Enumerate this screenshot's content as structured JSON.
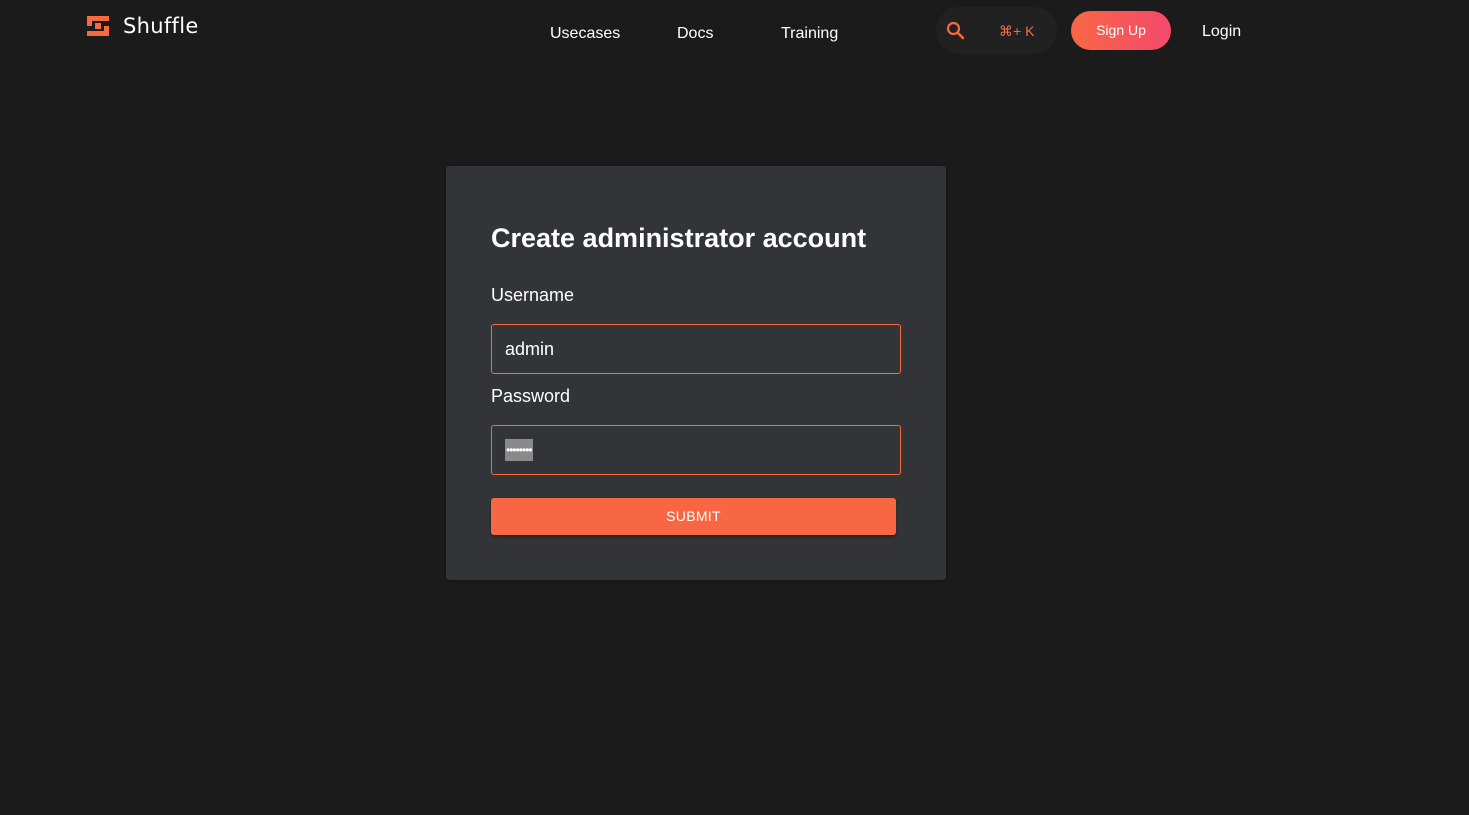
{
  "navbar": {
    "brand": {
      "name": "Shuffle",
      "logo_icon": "shuffle-logo-icon"
    },
    "links": [
      {
        "label": "Usecases"
      },
      {
        "label": "Docs"
      },
      {
        "label": "Training"
      }
    ],
    "search": {
      "icon": "search-icon",
      "shortcut": "⌘+ K"
    },
    "signup_label": "Sign Up",
    "login_label": "Login"
  },
  "form": {
    "title": "Create administrator account",
    "username": {
      "label": "Username",
      "value": "admin"
    },
    "password": {
      "label": "Password",
      "masked_value": "••••••••"
    },
    "submit_label": "SUBMIT"
  },
  "colors": {
    "background": "#1b1b1b",
    "card": "#333437",
    "accent": "#f86a3e",
    "signup_gradient_end": "#f4496d"
  }
}
